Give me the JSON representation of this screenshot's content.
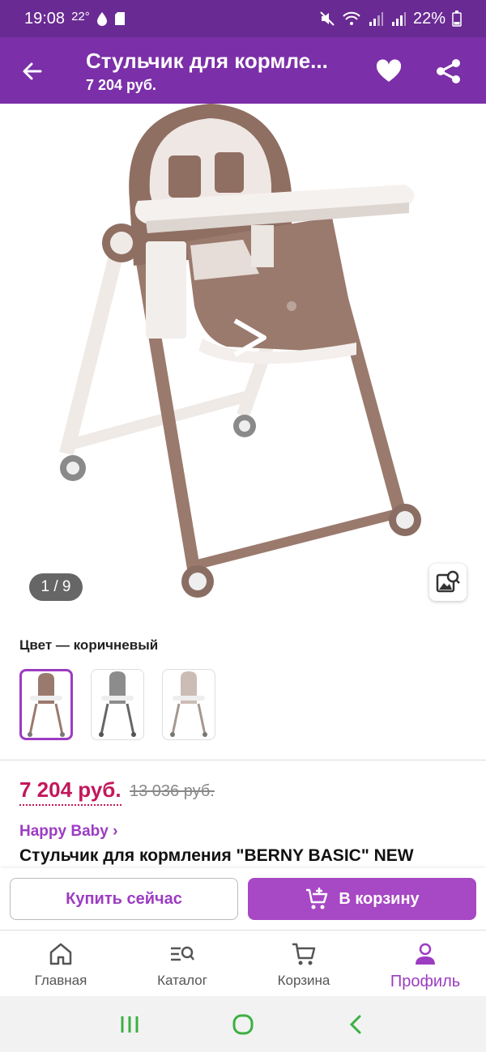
{
  "status_bar": {
    "time": "19:08",
    "temperature": "22°",
    "battery": "22%"
  },
  "app_bar": {
    "title": "Стульчик для кормле...",
    "price": "7 204 руб."
  },
  "gallery": {
    "counter": "1 / 9",
    "image_index": 1,
    "image_total": 9
  },
  "color": {
    "label": "Цвет — коричневый",
    "swatches": [
      {
        "name": "коричневый",
        "selected": true,
        "seat_color": "#9a7a6d"
      },
      {
        "name": "серый",
        "selected": false,
        "seat_color": "#8c8c8c"
      },
      {
        "name": "бежевый",
        "selected": false,
        "seat_color": "#cbbcb5"
      }
    ]
  },
  "pricing": {
    "current": "7 204 руб.",
    "old": "13 036 руб."
  },
  "product": {
    "brand": "Happy Baby ›",
    "name": "Стульчик для кормления \"BERNY BASIC\" NEW"
  },
  "actions": {
    "buy_now": "Купить сейчас",
    "add_to_cart": "В корзину"
  },
  "bottom_nav": {
    "items": [
      {
        "label": "Главная",
        "icon": "home-icon",
        "active": false
      },
      {
        "label": "Каталог",
        "icon": "catalog-icon",
        "active": false
      },
      {
        "label": "Корзина",
        "icon": "cart-icon",
        "active": false
      },
      {
        "label": "Профиль",
        "icon": "profile-icon",
        "active": true
      }
    ]
  },
  "colors": {
    "status_bar": "#6a2a93",
    "app_bar": "#7b2fa8",
    "accent": "#9c3cc2",
    "price": "#c2185b",
    "system_nav_icons": "#3cb043"
  }
}
